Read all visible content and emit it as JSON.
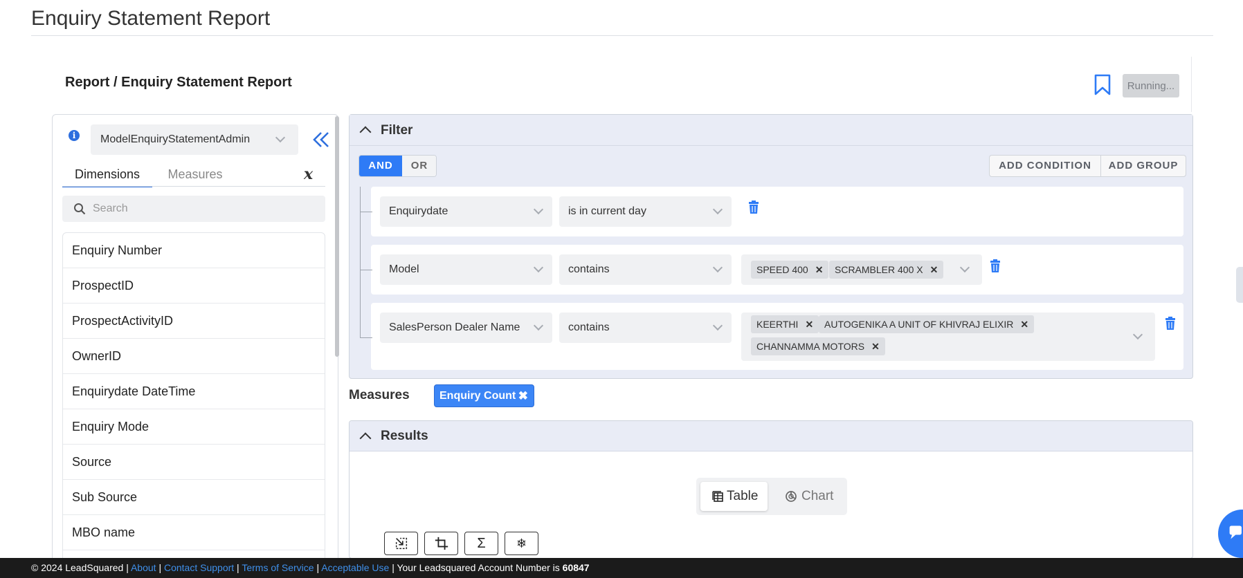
{
  "page": {
    "title": "Enquiry Statement Report",
    "breadcrumb": "Report / Enquiry Statement Report",
    "running_label": "Running..."
  },
  "left_panel": {
    "data_model": "ModelEnquiryStatementAdmin",
    "tabs": {
      "dimensions": "Dimensions",
      "measures": "Measures"
    },
    "search_placeholder": "Search",
    "dimensions": [
      "Enquiry Number",
      "ProspectID",
      "ProspectActivityID",
      "OwnerID",
      "Enquirydate DateTime",
      "Enquiry Mode",
      "Source",
      "Sub Source",
      "MBO name"
    ]
  },
  "filter": {
    "title": "Filter",
    "and_label": "AND",
    "or_label": "OR",
    "add_condition": "ADD CONDITION",
    "add_group": "ADD GROUP",
    "conditions": [
      {
        "field": "Enquirydate",
        "operator": "is in current day",
        "values": []
      },
      {
        "field": "Model",
        "operator": "contains",
        "values": [
          "SPEED 400",
          "SCRAMBLER 400 X"
        ]
      },
      {
        "field": "SalesPerson Dealer Name",
        "operator": "contains",
        "values": [
          "KEERTHI",
          "AUTOGENIKA A UNIT OF KHIVRAJ ELIXIR",
          "CHANNAMMA MOTORS"
        ]
      }
    ]
  },
  "measures": {
    "label": "Measures",
    "chips": [
      "Enquiry Count"
    ]
  },
  "results": {
    "title": "Results",
    "table_label": "Table",
    "chart_label": "Chart"
  },
  "footer": {
    "copyright": "© 2024 LeadSquared |",
    "links": [
      "About",
      "Contact Support",
      "Terms of Service",
      "Acceptable Use"
    ],
    "account_text": "| Your Leadsquared Account Number is",
    "account_number": "60847"
  },
  "colors": {
    "accent": "#2e7bf6",
    "panel_header": "#e9ecf6",
    "footer_bg": "#1b1b1b"
  }
}
